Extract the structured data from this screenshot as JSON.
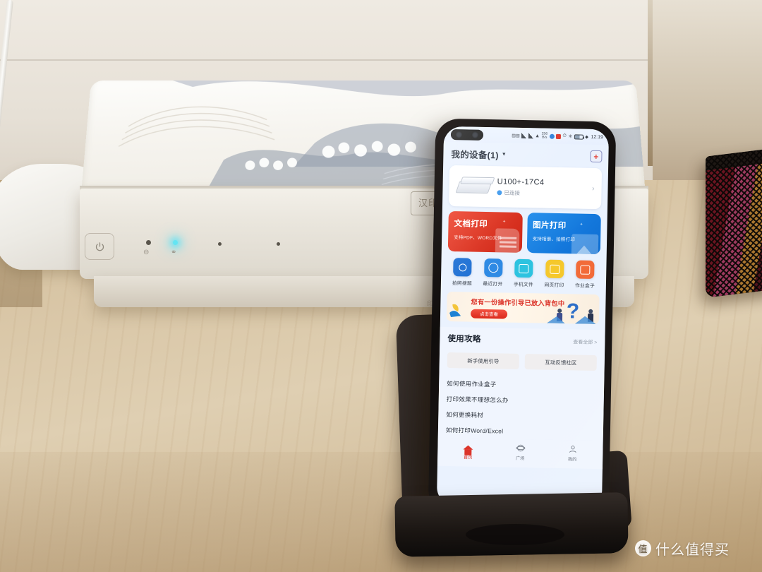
{
  "scene": {
    "description": "Photo of a white inkjet printer on a wooden desk with a phone in a black stand showing a printer app",
    "watermark": {
      "badge_text": "值",
      "text": "什么值得买"
    }
  },
  "printer": {
    "logo_text": "汉印",
    "side_text": "汉印",
    "power_icon": "power-icon",
    "indicator_labels": [
      "paper-indicator",
      "link-indicator"
    ]
  },
  "phone": {
    "statusbar": {
      "network_speed": "256\nB/s",
      "clock": "12:19",
      "icons": [
        "dual-sim-icon",
        "signal-bars-icon",
        "signal-bars-icon",
        "wifi-icon",
        "message-icon",
        "app-icon",
        "alarm-icon",
        "bluetooth-icon",
        "battery-icon",
        "vpn-icon"
      ]
    },
    "header": {
      "title": "我的设备(1)",
      "caret": "▼",
      "add_label": "+"
    },
    "device_card": {
      "name": "U100+-17C4",
      "status": "已连接",
      "chevron": "›"
    },
    "big_cards": [
      {
        "title": "文档打印",
        "subtitle": "支持PDF、WORD文件",
        "color": "#d4301f"
      },
      {
        "title": "图片打印",
        "subtitle": "支持相册、拍照打印",
        "color": "#1577d8"
      }
    ],
    "quick_icons": [
      {
        "label": "拍照搜题",
        "color": "#1f6fd0",
        "glyph": "camera-search-icon"
      },
      {
        "label": "最近打开",
        "color": "#2f88e0",
        "glyph": "clock-icon"
      },
      {
        "label": "手机文件",
        "color": "#2fc0dd",
        "glyph": "file-icon"
      },
      {
        "label": "网页打印",
        "color": "#f2c62f",
        "glyph": "webpage-icon"
      },
      {
        "label": "作业盒子",
        "color": "#ed6a3a",
        "glyph": "homework-box-icon"
      }
    ],
    "banner": {
      "text": "您有一份操作引导已放入背包中",
      "button_label": "点击查看",
      "question_mark": "?"
    },
    "guide": {
      "title": "使用攻略",
      "more_label": "查看全部 >",
      "chips": [
        "新手使用引导",
        "互动反馈社区"
      ],
      "items": [
        "如何使用作业盒子",
        "打印效果不理想怎么办",
        "如何更换耗材",
        "如何打印Word/Excel"
      ]
    },
    "bottom_nav": [
      {
        "label": "首页",
        "glyph": "home-icon",
        "active": true
      },
      {
        "label": "广场",
        "glyph": "plaza-icon",
        "active": false
      },
      {
        "label": "我的",
        "glyph": "profile-icon",
        "active": false
      }
    ]
  }
}
